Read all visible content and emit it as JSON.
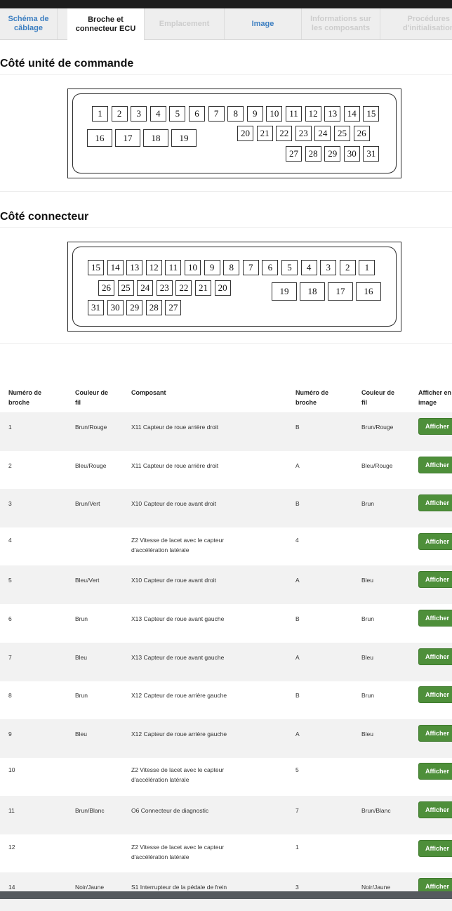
{
  "tabs": [
    {
      "label": "Schéma de\ncâblage"
    },
    {
      "label": "Broche et\nconnecteur ECU"
    },
    {
      "label": "Emplacement"
    },
    {
      "label": "Image"
    },
    {
      "label": "Informations sur\nles composants"
    },
    {
      "label": "Procédures\nd'initialisation"
    }
  ],
  "sections": {
    "control_unit_title": "Côté unité de commande",
    "connector_title": "Côté connecteur"
  },
  "control_pins": [
    "1",
    "2",
    "3",
    "4",
    "5",
    "6",
    "7",
    "8",
    "9",
    "10",
    "11",
    "12",
    "13",
    "14",
    "15",
    "16",
    "17",
    "18",
    "19",
    "20",
    "21",
    "22",
    "23",
    "24",
    "25",
    "26",
    "27",
    "28",
    "29",
    "30",
    "31"
  ],
  "connector_pins": [
    "15",
    "14",
    "13",
    "12",
    "11",
    "10",
    "9",
    "8",
    "7",
    "6",
    "5",
    "4",
    "3",
    "2",
    "1",
    "26",
    "25",
    "24",
    "23",
    "22",
    "21",
    "20",
    "19",
    "18",
    "17",
    "16",
    "31",
    "30",
    "29",
    "28",
    "27"
  ],
  "table": {
    "headers": [
      "Numéro de\nbroche",
      "Couleur de\nfil",
      "Composant",
      "Numéro de\nbroche",
      "Couleur de\nfil",
      "Afficher en\nimage"
    ],
    "button_label": "Afficher",
    "rows": [
      {
        "pin": "1",
        "color": "Brun/Rouge",
        "component": "X11 Capteur de roue arrière droit",
        "pin2": "B",
        "color2": "Brun/Rouge"
      },
      {
        "pin": "2",
        "color": "Bleu/Rouge",
        "component": "X11 Capteur de roue arrière droit",
        "pin2": "A",
        "color2": "Bleu/Rouge"
      },
      {
        "pin": "3",
        "color": "Brun/Vert",
        "component": "X10 Capteur de roue avant droit",
        "pin2": "B",
        "color2": "Brun"
      },
      {
        "pin": "4",
        "color": "",
        "component": "Z2 Vitesse de lacet avec le capteur\nd'accélération latérale",
        "pin2": "4",
        "color2": ""
      },
      {
        "pin": "5",
        "color": "Bleu/Vert",
        "component": "X10 Capteur de roue avant droit",
        "pin2": "A",
        "color2": "Bleu"
      },
      {
        "pin": "6",
        "color": "Brun",
        "component": "X13 Capteur de roue avant gauche",
        "pin2": "B",
        "color2": "Brun"
      },
      {
        "pin": "7",
        "color": "Bleu",
        "component": "X13 Capteur de roue avant gauche",
        "pin2": "A",
        "color2": "Bleu"
      },
      {
        "pin": "8",
        "color": "Brun",
        "component": "X12 Capteur de roue arrière gauche",
        "pin2": "B",
        "color2": "Brun"
      },
      {
        "pin": "9",
        "color": "Bleu",
        "component": "X12 Capteur de roue arrière gauche",
        "pin2": "A",
        "color2": "Bleu"
      },
      {
        "pin": "10",
        "color": "",
        "component": "Z2 Vitesse de lacet avec le capteur\nd'accélération latérale",
        "pin2": "5",
        "color2": ""
      },
      {
        "pin": "11",
        "color": "Brun/Blanc",
        "component": "O6 Connecteur de diagnostic",
        "pin2": "7",
        "color2": "Brun/Blanc"
      },
      {
        "pin": "12",
        "color": "",
        "component": "Z2 Vitesse de lacet avec le capteur\nd'accélération latérale",
        "pin2": "1",
        "color2": ""
      },
      {
        "pin": "14",
        "color": "Noir/Jaune",
        "component": "S1 Interrupteur de la pédale de frein",
        "pin2": "3",
        "color2": "Noir/Jaune"
      }
    ]
  }
}
